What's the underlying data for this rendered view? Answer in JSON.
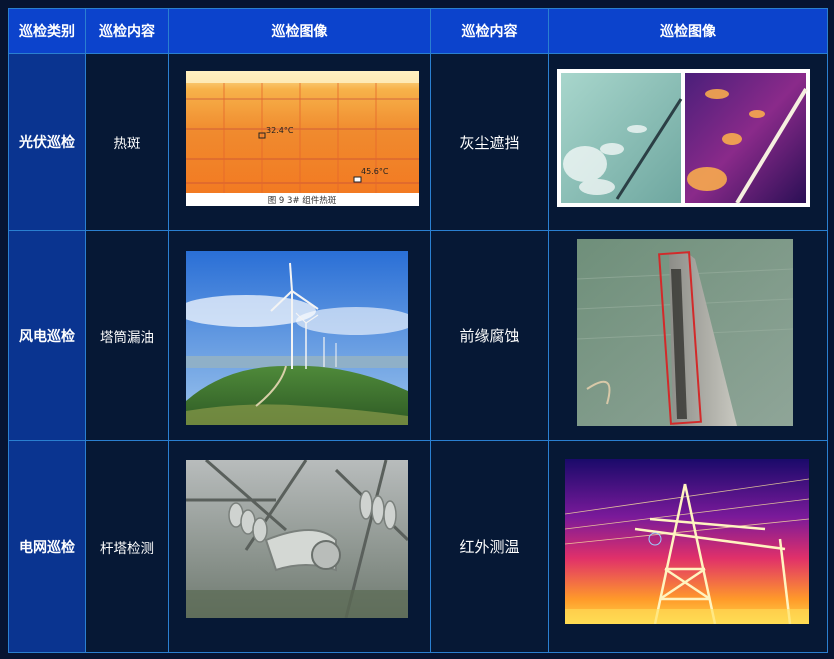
{
  "headers": {
    "category": "巡检类别",
    "content_left": "巡检内容",
    "image_left": "巡检图像",
    "content_right": "巡检内容",
    "image_right": "巡检图像"
  },
  "rows": [
    {
      "category": "光伏巡检",
      "content_left": "热斑",
      "content_right": "灰尘遮挡",
      "thermal_labels": [
        "32.4°C",
        "45.6°C"
      ],
      "figure_caption": "图 9  3# 组件热斑"
    },
    {
      "category": "风电巡检",
      "content_left": "塔筒漏油",
      "content_right": "前缘腐蚀"
    },
    {
      "category": "电网巡检",
      "content_left": "杆塔检测",
      "content_right": "红外测温"
    }
  ],
  "colors": {
    "header_bg": "#0c43cc",
    "category_bg": "#0a3490",
    "body_bg": "#061835",
    "border": "#2a7fd0"
  }
}
